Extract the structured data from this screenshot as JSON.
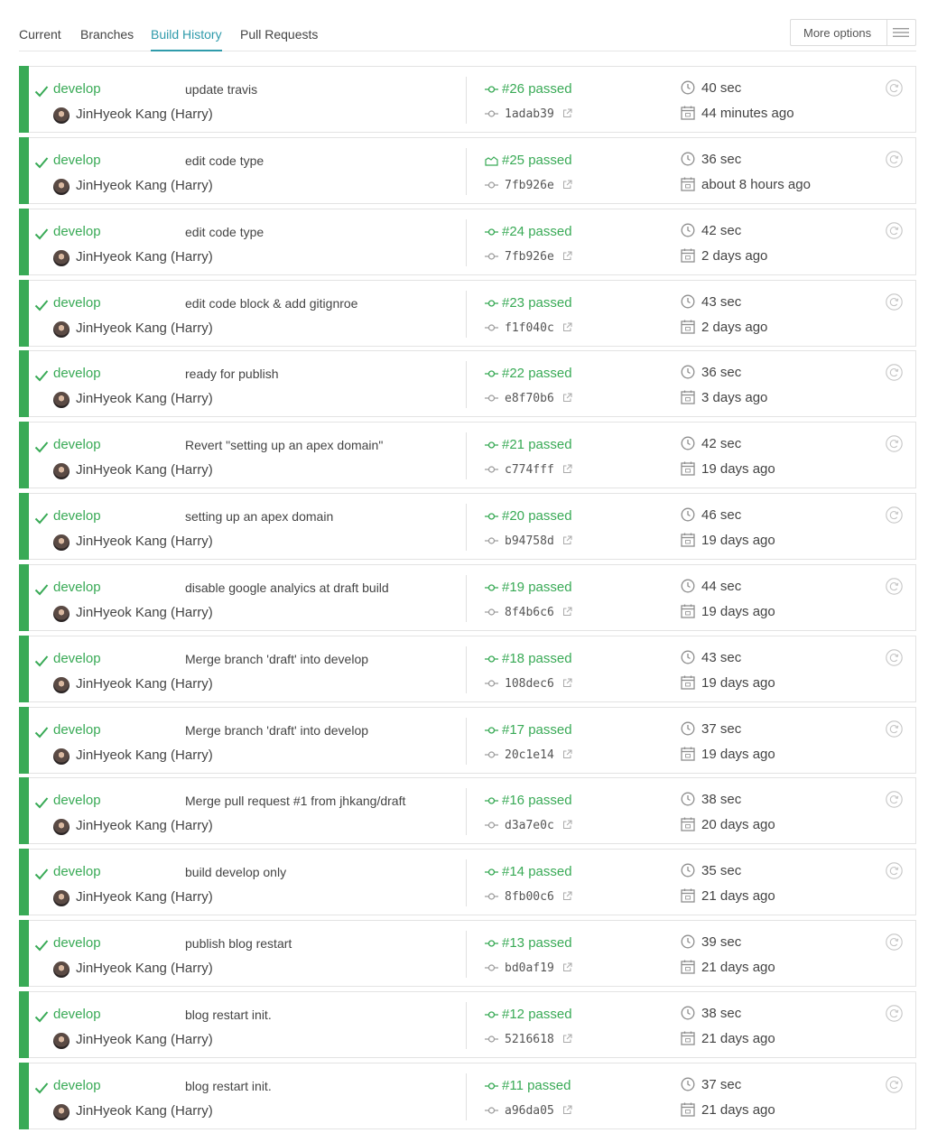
{
  "tabs": [
    {
      "label": "Current",
      "active": false
    },
    {
      "label": "Branches",
      "active": false
    },
    {
      "label": "Build History",
      "active": true
    },
    {
      "label": "Pull Requests",
      "active": false
    }
  ],
  "more_options": {
    "label": "More options",
    "icon": "hamburger-menu-icon"
  },
  "colors": {
    "passed": "#39aa56",
    "accent": "#2f9bab",
    "text": "#444444",
    "muted": "#8e8e8e"
  },
  "builds": [
    {
      "branch": "develop",
      "message": "update travis",
      "author": "JinHyeok Kang (Harry)",
      "number": "#26 passed",
      "build_icon": "commit-node-icon",
      "commit": "1adab39",
      "duration": "40 sec",
      "date": "44 minutes ago"
    },
    {
      "branch": "develop",
      "message": "edit code type",
      "author": "JinHyeok Kang (Harry)",
      "number": "#25 passed",
      "build_icon": "cloud-icon",
      "commit": "7fb926e",
      "duration": "36 sec",
      "date": "about 8 hours ago"
    },
    {
      "branch": "develop",
      "message": "edit code type",
      "author": "JinHyeok Kang (Harry)",
      "number": "#24 passed",
      "build_icon": "commit-node-icon",
      "commit": "7fb926e",
      "duration": "42 sec",
      "date": "2 days ago"
    },
    {
      "branch": "develop",
      "message": "edit code block & add gitignroe",
      "author": "JinHyeok Kang (Harry)",
      "number": "#23 passed",
      "build_icon": "commit-node-icon",
      "commit": "f1f040c",
      "duration": "43 sec",
      "date": "2 days ago"
    },
    {
      "branch": "develop",
      "message": "ready for publish",
      "author": "JinHyeok Kang (Harry)",
      "number": "#22 passed",
      "build_icon": "commit-node-icon",
      "commit": "e8f70b6",
      "duration": "36 sec",
      "date": "3 days ago"
    },
    {
      "branch": "develop",
      "message": "Revert \"setting up an apex domain\"",
      "author": "JinHyeok Kang (Harry)",
      "number": "#21 passed",
      "build_icon": "commit-node-icon",
      "commit": "c774fff",
      "duration": "42 sec",
      "date": "19 days ago"
    },
    {
      "branch": "develop",
      "message": "setting up an apex domain",
      "author": "JinHyeok Kang (Harry)",
      "number": "#20 passed",
      "build_icon": "commit-node-icon",
      "commit": "b94758d",
      "duration": "46 sec",
      "date": "19 days ago"
    },
    {
      "branch": "develop",
      "message": "disable google analyics at draft build",
      "author": "JinHyeok Kang (Harry)",
      "number": "#19 passed",
      "build_icon": "commit-node-icon",
      "commit": "8f4b6c6",
      "duration": "44 sec",
      "date": "19 days ago"
    },
    {
      "branch": "develop",
      "message": "Merge branch 'draft' into develop",
      "author": "JinHyeok Kang (Harry)",
      "number": "#18 passed",
      "build_icon": "commit-node-icon",
      "commit": "108dec6",
      "duration": "43 sec",
      "date": "19 days ago"
    },
    {
      "branch": "develop",
      "message": "Merge branch 'draft' into develop",
      "author": "JinHyeok Kang (Harry)",
      "number": "#17 passed",
      "build_icon": "commit-node-icon",
      "commit": "20c1e14",
      "duration": "37 sec",
      "date": "19 days ago"
    },
    {
      "branch": "develop",
      "message": "Merge pull request #1 from jhkang/draft",
      "author": "JinHyeok Kang (Harry)",
      "number": "#16 passed",
      "build_icon": "commit-node-icon",
      "commit": "d3a7e0c",
      "duration": "38 sec",
      "date": "20 days ago"
    },
    {
      "branch": "develop",
      "message": "build develop only",
      "author": "JinHyeok Kang (Harry)",
      "number": "#14 passed",
      "build_icon": "commit-node-icon",
      "commit": "8fb00c6",
      "duration": "35 sec",
      "date": "21 days ago"
    },
    {
      "branch": "develop",
      "message": "publish blog restart",
      "author": "JinHyeok Kang (Harry)",
      "number": "#13 passed",
      "build_icon": "commit-node-icon",
      "commit": "bd0af19",
      "duration": "39 sec",
      "date": "21 days ago"
    },
    {
      "branch": "develop",
      "message": "blog restart init.",
      "author": "JinHyeok Kang (Harry)",
      "number": "#12 passed",
      "build_icon": "commit-node-icon",
      "commit": "5216618",
      "duration": "38 sec",
      "date": "21 days ago"
    },
    {
      "branch": "develop",
      "message": "blog restart init.",
      "author": "JinHyeok Kang (Harry)",
      "number": "#11 passed",
      "build_icon": "commit-node-icon",
      "commit": "a96da05",
      "duration": "37 sec",
      "date": "21 days ago"
    }
  ]
}
